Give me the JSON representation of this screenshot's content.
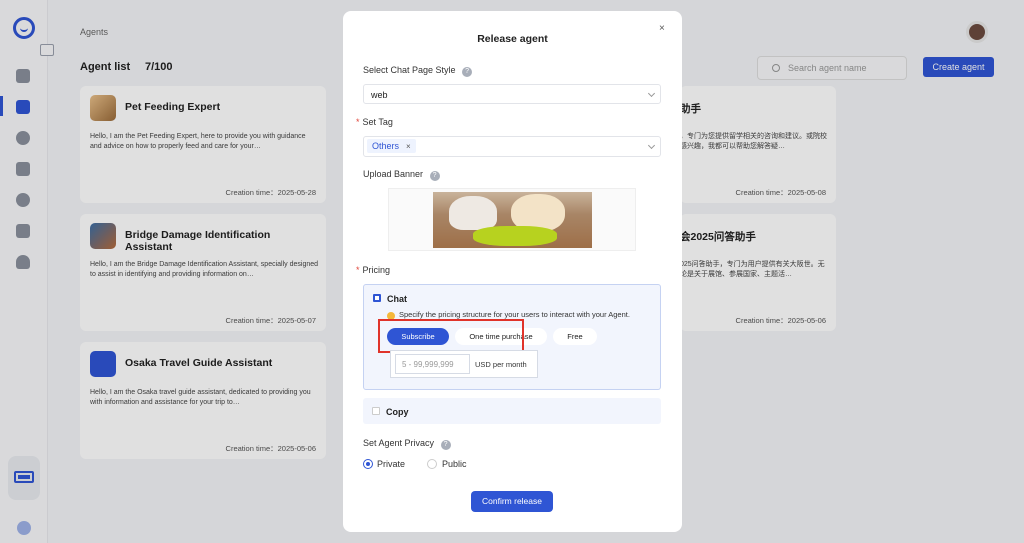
{
  "header": {
    "breadcrumb": "Agents",
    "list_title": "Agent list",
    "list_count": "7/100",
    "search_placeholder": "Search agent name",
    "create_label": "Create agent"
  },
  "cards": [
    {
      "name": "Pet Feeding Expert",
      "desc": "Hello, I am the Pet Feeding Expert, here to provide you with guidance and advice on how to properly feed and care for your…",
      "time": "Creation time：2025-05-28"
    },
    {
      "name": "Bridge Damage Identification Assistant",
      "desc": "Hello, I am the Bridge Damage Identification Assistant, specially designed to assist in identifying and providing information on…",
      "time": "Creation time：2025-05-07"
    },
    {
      "name": "Osaka Travel Guide Assistant",
      "desc": "Hello, I am the Osaka travel guide assistant, dedicated to providing you with information and assistance for your trip to…",
      "time": "Creation time：2025-05-06"
    }
  ],
  "right_cards": [
    {
      "name": "助手",
      "desc": "，专门为您提供留学相关的咨询和建议。或院校感兴趣，我都可以帮助您解答疑…",
      "time": "Creation time：2025-05-08"
    },
    {
      "name": "会2025问答助手",
      "desc": "025问答助手，专门为用户提供有关大阪世。无论是关于展馆、参展国家、主题活…",
      "time": "Creation time：2025-05-06"
    }
  ],
  "modal": {
    "title": "Release agent",
    "close": "×",
    "page_style_label": "Select Chat Page Style",
    "page_style_value": "web",
    "tag_label": "Set Tag",
    "tag_value": "Others",
    "tag_remove": "×",
    "banner_label": "Upload Banner",
    "pricing_label": "Pricing",
    "chat_label": "Chat",
    "chat_checked": true,
    "pricing_hint": "Specify the pricing structure for your users to interact with your Agent.",
    "pricing_options": [
      "Subscribe",
      "One time purchase",
      "Free"
    ],
    "pricing_selected": "Subscribe",
    "price_placeholder": "5 - 99,999,999",
    "price_unit": "USD  per month",
    "copy_label": "Copy",
    "copy_checked": false,
    "privacy_label": "Set Agent Privacy",
    "privacy_options": [
      "Private",
      "Public"
    ],
    "privacy_selected": "Private",
    "confirm_label": "Confirm release",
    "help_glyph": "?",
    "required_mark": "*"
  },
  "colors": {
    "accent": "#2f55d4",
    "highlight": "#e0332a",
    "required": "#e0453a"
  },
  "icons": [
    "logo-icon",
    "chat-icon",
    "agent-icon",
    "explore-icon",
    "team-icon",
    "settings-icon",
    "store-icon",
    "robot-icon",
    "battery-icon",
    "search-icon",
    "chevron-down-icon",
    "close-icon",
    "help-icon",
    "lightbulb-icon"
  ]
}
